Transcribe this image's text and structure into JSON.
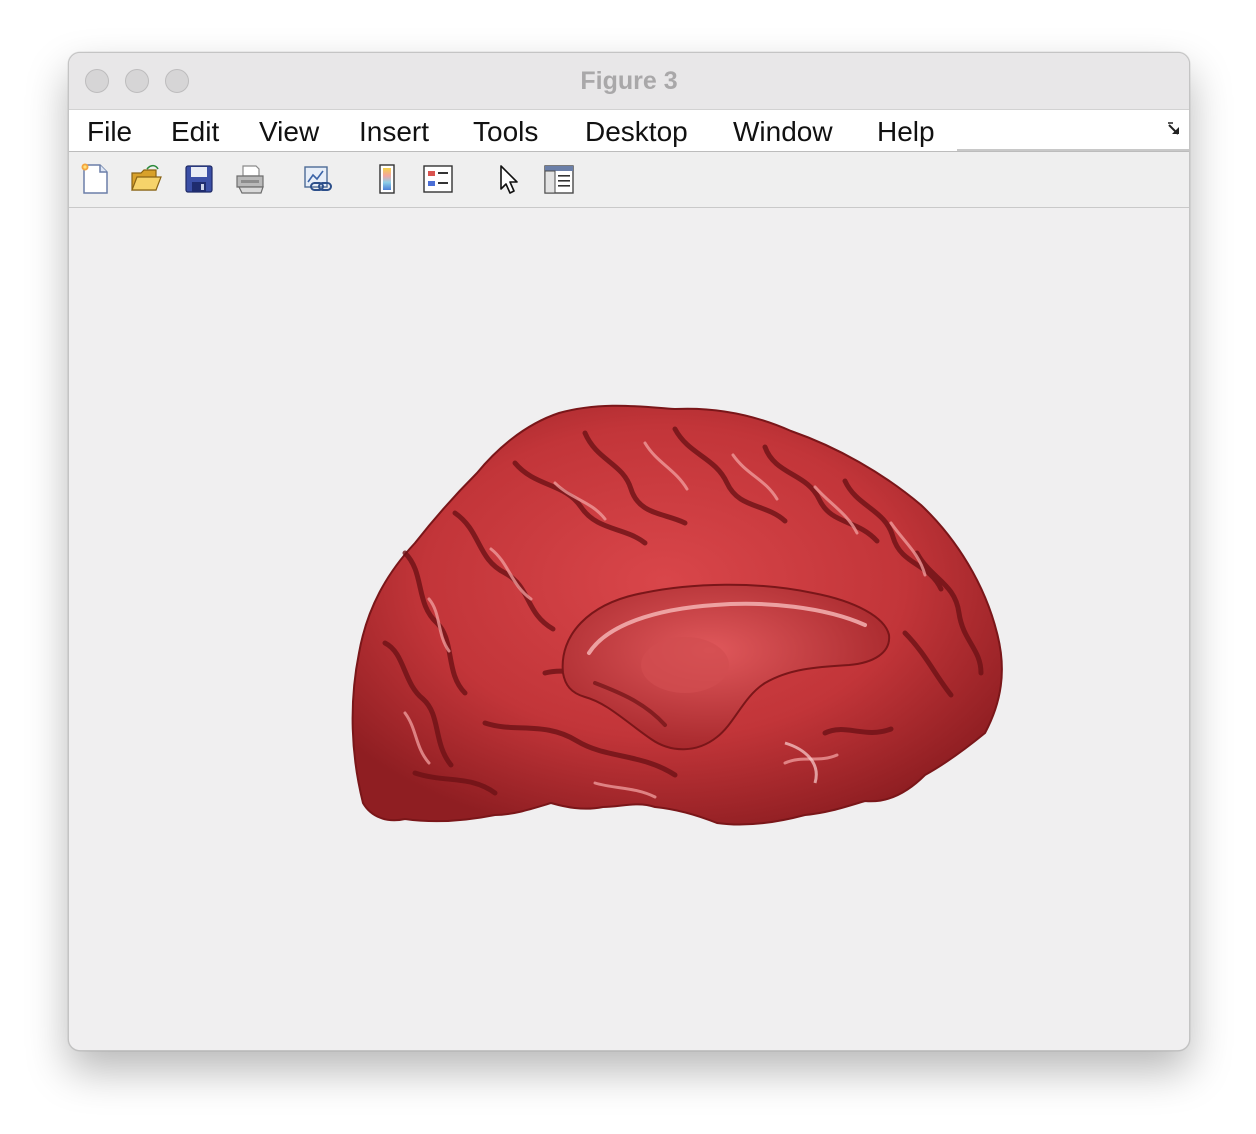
{
  "window": {
    "title": "Figure 3"
  },
  "menubar": {
    "items": [
      "File",
      "Edit",
      "View",
      "Insert",
      "Tools",
      "Desktop",
      "Window",
      "Help"
    ]
  },
  "toolbar": {
    "tools": [
      {
        "icon": "new-figure-icon"
      },
      {
        "icon": "open-file-icon"
      },
      {
        "icon": "save-icon"
      },
      {
        "icon": "print-icon"
      },
      {
        "icon": "link-plot-icon"
      },
      {
        "icon": "colorbar-icon"
      },
      {
        "icon": "legend-icon"
      },
      {
        "icon": "edit-plot-cursor-icon"
      },
      {
        "icon": "property-inspector-icon"
      }
    ]
  },
  "figure": {
    "surface_color": "#c8393d",
    "background_color": "#f0eff0"
  }
}
